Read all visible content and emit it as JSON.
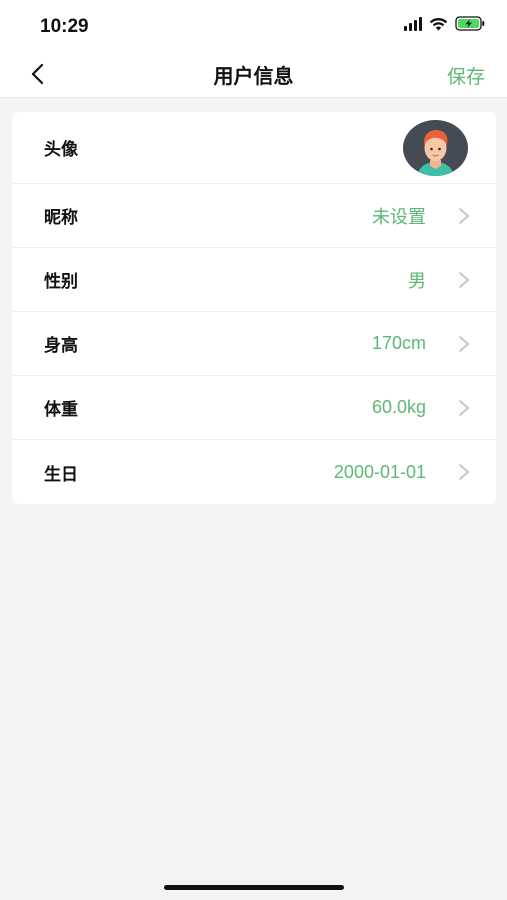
{
  "status_bar": {
    "time": "10:29",
    "icons": [
      "signal-icon",
      "wifi-icon",
      "battery-charging-icon"
    ]
  },
  "nav": {
    "back_icon": "chevron-left-icon",
    "title": "用户信息",
    "save_label": "保存"
  },
  "colors": {
    "accent": "#5cb872",
    "background": "#f4f4f4",
    "card": "#ffffff",
    "battery": "#4cd964"
  },
  "profile": {
    "avatar_label": "头像",
    "rows": [
      {
        "label": "昵称",
        "value": "未设置"
      },
      {
        "label": "性别",
        "value": "男"
      },
      {
        "label": "身高",
        "value": "170cm"
      },
      {
        "label": "体重",
        "value": "60.0kg"
      },
      {
        "label": "生日",
        "value": "2000-01-01"
      }
    ]
  }
}
